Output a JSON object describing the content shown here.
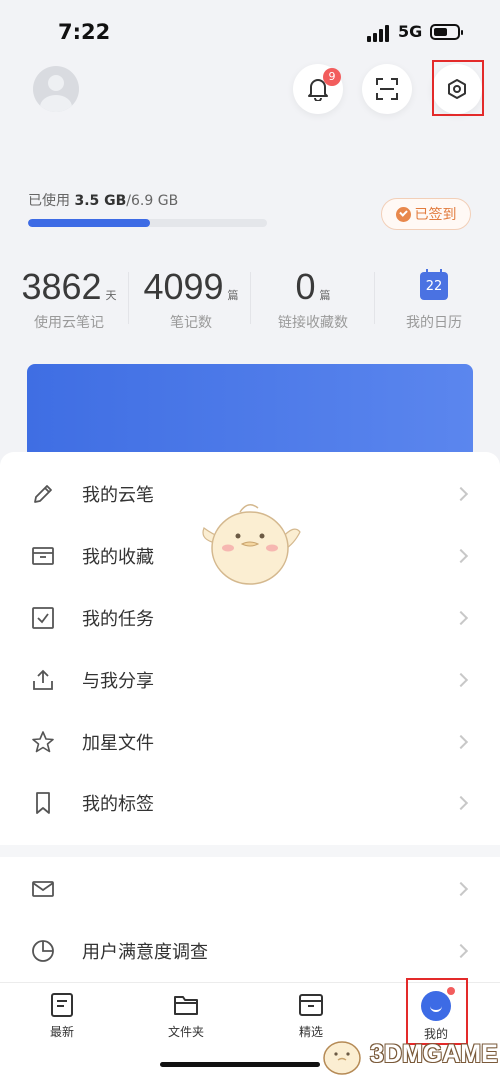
{
  "status_bar": {
    "time": "7:22",
    "network": "5G"
  },
  "header": {
    "notification_count": "9"
  },
  "storage": {
    "prefix": "已使用 ",
    "used": "3.5 GB",
    "total": "/6.9 GB",
    "used_fraction": 0.51
  },
  "sign_in": {
    "label": "已签到"
  },
  "stats": [
    {
      "value": "3862",
      "unit": "天",
      "label": "使用云笔记"
    },
    {
      "value": "4099",
      "unit": "篇",
      "label": "笔记数"
    },
    {
      "value": "0",
      "unit": "篇",
      "label": "链接收藏数"
    },
    {
      "value": "22",
      "unit": "",
      "label": "我的日历"
    }
  ],
  "menu": {
    "items": [
      {
        "label": "我的云笔",
        "icon": "pencil-icon"
      },
      {
        "label": "我的收藏",
        "icon": "inbox-icon"
      },
      {
        "label": "我的任务",
        "icon": "checkbox-icon"
      },
      {
        "label": "与我分享",
        "icon": "share-icon"
      },
      {
        "label": "加星文件",
        "icon": "star-icon"
      },
      {
        "label": "我的标签",
        "icon": "bookmark-icon"
      }
    ],
    "secondary": [
      {
        "label": "",
        "icon": "mail-icon"
      },
      {
        "label": "用户满意度调查",
        "icon": "pie-chart-icon"
      }
    ]
  },
  "tabs": [
    {
      "label": "最新",
      "icon": "document-icon"
    },
    {
      "label": "文件夹",
      "icon": "folder-icon"
    },
    {
      "label": "精选",
      "icon": "box-icon"
    },
    {
      "label": "我的",
      "icon": "me-icon"
    }
  ],
  "watermark": {
    "text": "3DMGAME"
  },
  "colors": {
    "accent": "#3d6be5",
    "highlight": "#e32a2a",
    "sign": "#e27c3e",
    "badge": "#f25d5d"
  }
}
